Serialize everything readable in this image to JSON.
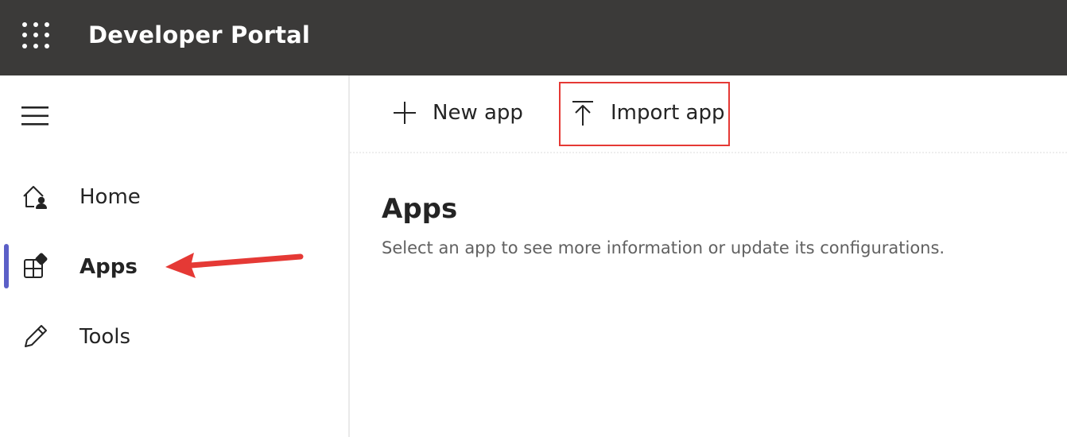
{
  "header": {
    "app_title": "Developer Portal",
    "waffle_icon": "app-launcher-waffle-icon",
    "background_color": "#3b3a39"
  },
  "sidebar": {
    "menu_icon": "hamburger-menu-icon",
    "active_item": "Apps",
    "accent_color": "#5b5fc7",
    "items": [
      {
        "label": "Home",
        "icon": "home-person-icon"
      },
      {
        "label": "Apps",
        "icon": "apps-grid-icon"
      },
      {
        "label": "Tools",
        "icon": "pencil-icon"
      }
    ]
  },
  "toolbar": {
    "new_app_label": "New app",
    "new_app_icon": "plus-icon",
    "import_app_label": "Import app",
    "import_app_icon": "upload-arrow-icon"
  },
  "main": {
    "title": "Apps",
    "subtitle": "Select an app to see more information or update its configurations."
  },
  "annotations": {
    "highlight_color": "#e53935"
  }
}
